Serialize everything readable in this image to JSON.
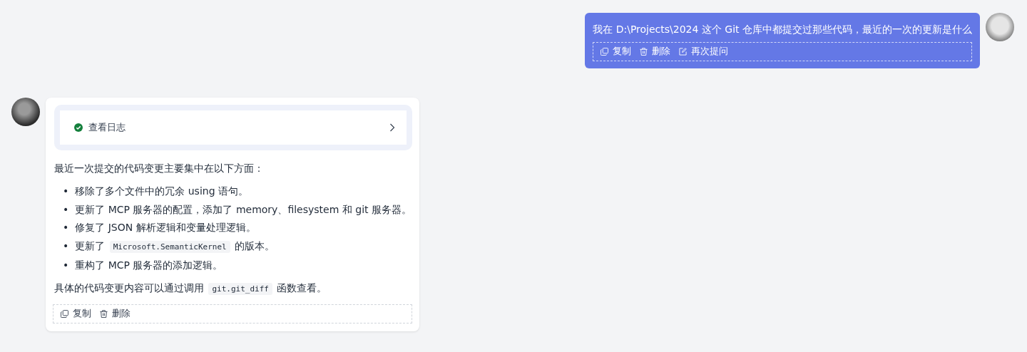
{
  "user_message": {
    "text": "我在 D:\\Projects\\2024 这个 Git 仓库中都提交过那些代码，最近的一次的更新是什么",
    "actions": [
      {
        "kind": "copy",
        "label": "复制"
      },
      {
        "kind": "delete",
        "label": "删除"
      },
      {
        "kind": "edit",
        "label": "再次提问"
      }
    ]
  },
  "assistant_message": {
    "tool_call": {
      "label": "查看日志",
      "completed": true
    },
    "intro": "最近一次提交的代码变更主要集中在以下方面：",
    "bullets": [
      {
        "marker": "•",
        "segments": [
          {
            "kind": "text",
            "text": "移除了多个文件中的冗余 using 语句。"
          }
        ]
      },
      {
        "marker": "•",
        "segments": [
          {
            "kind": "text",
            "text": "更新了 MCP 服务器的配置，添加了 memory、filesystem 和 git 服务器。"
          }
        ]
      },
      {
        "marker": "•",
        "segments": [
          {
            "kind": "text",
            "text": "修复了 JSON 解析逻辑和变量处理逻辑。"
          }
        ]
      },
      {
        "marker": "•",
        "segments": [
          {
            "kind": "text",
            "text": "更新了 "
          },
          {
            "kind": "code",
            "text": "Microsoft.SemanticKernel"
          },
          {
            "kind": "text",
            "text": " 的版本。"
          }
        ]
      },
      {
        "marker": "•",
        "segments": [
          {
            "kind": "text",
            "text": "重构了 MCP 服务器的添加逻辑。"
          }
        ]
      }
    ],
    "closing": [
      {
        "kind": "text",
        "text": "具体的代码变更内容可以通过调用 "
      },
      {
        "kind": "code",
        "text": "git.git_diff"
      },
      {
        "kind": "text",
        "text": " 函数查看。"
      }
    ],
    "actions": [
      {
        "kind": "copy",
        "label": "复制"
      },
      {
        "kind": "delete",
        "label": "删除"
      }
    ]
  }
}
